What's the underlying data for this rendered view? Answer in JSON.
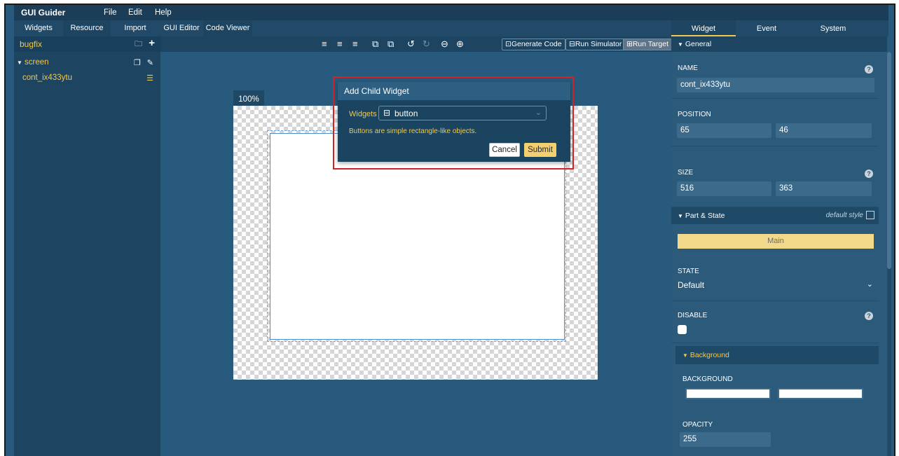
{
  "app": {
    "title": "GUI Guider"
  },
  "menu": [
    "File",
    "Edit",
    "Help"
  ],
  "left_tabs": [
    "Widgets",
    "Resource",
    "Import"
  ],
  "editor_tabs": [
    "GUI Editor",
    "Code Viewer"
  ],
  "right_tabs": [
    "Widget",
    "Event",
    "System"
  ],
  "project": {
    "name": "bugfix"
  },
  "tree": {
    "screen_label": "screen",
    "container_label": "cont_ix433ytu"
  },
  "toolbar": {
    "generate_code": "Generate Code",
    "run_simulator": "Run Simulator",
    "run_target": "Run Target"
  },
  "canvas": {
    "zoom": "100%"
  },
  "dialog": {
    "title": "Add Child Widget",
    "widgets_label": "Widgets :",
    "selected_widget": "button",
    "description": "Buttons are simple rectangle-like objects.",
    "cancel_label": "Cancel",
    "submit_label": "Submit"
  },
  "properties": {
    "general_label": "General",
    "name_label": "NAME",
    "name_value": "cont_ix433ytu",
    "position_label": "POSITION",
    "position_x": "65",
    "position_y": "46",
    "size_label": "SIZE",
    "size_w": "516",
    "size_h": "363",
    "part_state_label": "Part & State",
    "default_style_label": "default style",
    "main_label": "Main",
    "state_label": "STATE",
    "state_value": "Default",
    "disable_label": "DISABLE",
    "background_section": "Background",
    "background_label": "BACKGROUND",
    "background_color": "#ffffff",
    "opacity_label": "OPACITY",
    "opacity_value": "255"
  },
  "colors": {
    "accent_yellow": "#f2c94c",
    "highlight_red": "#d2232a",
    "panel_blue": "#1d4562",
    "canvas_bg": "#275a7d"
  }
}
